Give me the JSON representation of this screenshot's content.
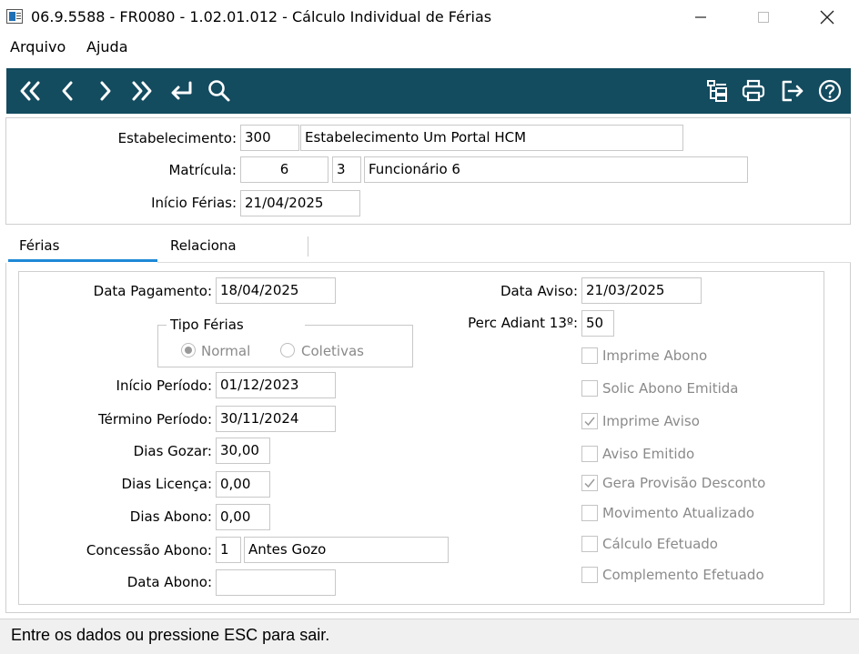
{
  "window": {
    "title": "06.9.5588 - FR0080 - 1.02.01.012 - Cálculo Individual de Férias",
    "minimize_glyph": "—",
    "maximize_glyph": "☐",
    "close_glyph": "✕"
  },
  "menu": {
    "arquivo": "Arquivo",
    "ajuda": "Ajuda"
  },
  "toolbar": {
    "icons": [
      "first-record-icon",
      "previous-record-icon",
      "next-record-icon",
      "last-record-icon",
      "goto-record-icon",
      "search-icon",
      "tree-view-icon",
      "print-icon",
      "exit-icon",
      "help-icon"
    ],
    "background": "#134b5f"
  },
  "header": {
    "estabelecimento_label": "Estabelecimento:",
    "estabelecimento_code": "300",
    "estabelecimento_name": "Estabelecimento Um Portal HCM",
    "matricula_label": "Matrícula:",
    "matricula_number": "6",
    "matricula_digit": "3",
    "matricula_name": "Funcionário 6",
    "inicio_ferias_label": "Início Férias:",
    "inicio_ferias_value": "21/04/2025"
  },
  "tabs": {
    "ferias": "Férias",
    "relaciona": "Relaciona",
    "active_color": "#1e88d6"
  },
  "form": {
    "data_pagamento_label": "Data Pagamento:",
    "data_pagamento_value": "18/04/2025",
    "tipo_ferias_label": "Tipo Férias",
    "tipo_normal": "Normal",
    "tipo_coletivas": "Coletivas",
    "tipo_selected": "Normal",
    "inicio_periodo_label": "Início Período:",
    "inicio_periodo_value": "01/12/2023",
    "termino_periodo_label": "Término Período:",
    "termino_periodo_value": "30/11/2024",
    "dias_gozar_label": "Dias Gozar:",
    "dias_gozar_value": "30,00",
    "dias_licenca_label": "Dias Licença:",
    "dias_licenca_value": "0,00",
    "dias_abono_label": "Dias Abono:",
    "dias_abono_value": "0,00",
    "concessao_abono_label": "Concessão Abono:",
    "concessao_abono_code": "1",
    "concessao_abono_desc": "Antes Gozo",
    "data_abono_label": "Data Abono:",
    "data_abono_value": "",
    "data_aviso_label": "Data Aviso:",
    "data_aviso_value": "21/03/2025",
    "perc_adiant_label": "Perc Adiant 13º:",
    "perc_adiant_value": "50",
    "checkboxes": [
      {
        "label": "Imprime Abono",
        "checked": false
      },
      {
        "label": "Solic Abono Emitida",
        "checked": false
      },
      {
        "label": "Imprime Aviso",
        "checked": true
      },
      {
        "label": "Aviso Emitido",
        "checked": false
      },
      {
        "label": "Gera Provisão Desconto",
        "checked": true
      },
      {
        "label": "Movimento Atualizado",
        "checked": false
      },
      {
        "label": "Cálculo Efetuado",
        "checked": false
      },
      {
        "label": "Complemento Efetuado",
        "checked": false
      }
    ]
  },
  "status": {
    "message": "Entre os dados ou pressione ESC para sair."
  }
}
